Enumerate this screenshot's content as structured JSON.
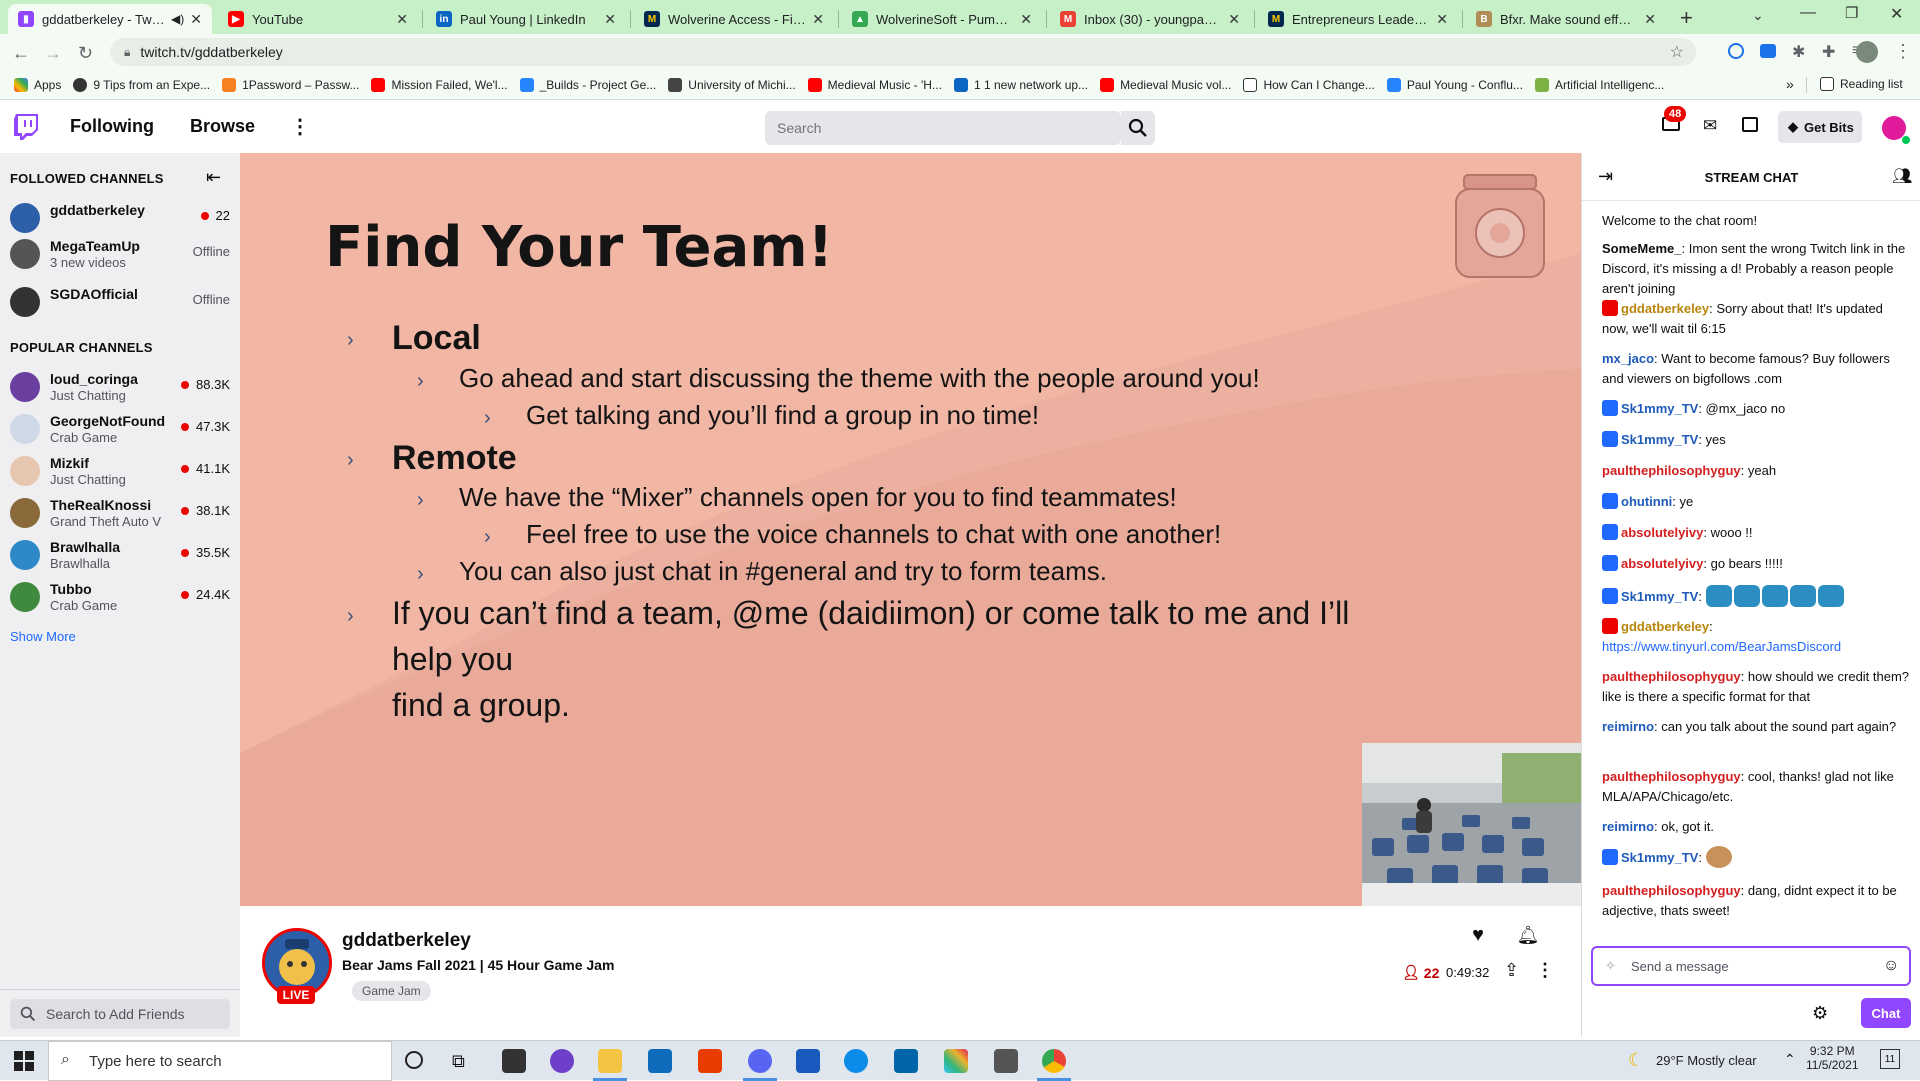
{
  "browser": {
    "tabs": [
      {
        "title": "gddatberkeley - Twitch",
        "active": true,
        "color": "#9147ff"
      },
      {
        "title": "YouTube",
        "active": false,
        "color": "#ff0000"
      },
      {
        "title": "Paul Young | LinkedIn",
        "active": false,
        "color": "#0a66c2"
      },
      {
        "title": "Wolverine Access - Find & ...",
        "active": false,
        "color": "#00274c"
      },
      {
        "title": "WolverineSoft - Pumpkin C...",
        "active": false,
        "color": "#34a853"
      },
      {
        "title": "Inbox (30) - youngpau@u...",
        "active": false,
        "color": "#ea4335"
      },
      {
        "title": "Entrepreneurs Leadership ...",
        "active": false,
        "color": "#00274c"
      },
      {
        "title": "Bfxr. Make sound effects f...",
        "active": false,
        "color": "#b08d57"
      }
    ],
    "url": "twitch.tv/gddatberkeley",
    "bookmarks": [
      "Apps",
      "9 Tips from an Expe...",
      "1Password – Passw...",
      "Mission Failed, We'l...",
      "_Builds - Project Ge...",
      "University of Michi...",
      "Medieval Music - 'H...",
      "1 1 new network up...",
      "Medieval Music vol...",
      "How Can I Change...",
      "Paul Young - Conflu...",
      "Artificial Intelligenc..."
    ],
    "reading_list": "Reading list",
    "more_bookmarks": "»"
  },
  "twitch": {
    "nav": {
      "following": "Following",
      "browse": "Browse",
      "search_placeholder": "Search",
      "notif_count": "48",
      "get_bits": "Get Bits"
    },
    "sidebar": {
      "followed_header": "FOLLOWED CHANNELS",
      "followed": [
        {
          "name": "gddatberkeley",
          "sub": "",
          "status": "22",
          "live": true,
          "color": "#2d5ea8"
        },
        {
          "name": "MegaTeamUp",
          "sub": "3 new videos",
          "status": "Offline",
          "live": false,
          "color": "#555"
        },
        {
          "name": "SGDAOfficial",
          "sub": "",
          "status": "Offline",
          "live": false,
          "color": "#333"
        }
      ],
      "popular_header": "POPULAR CHANNELS",
      "popular": [
        {
          "name": "loud_coringa",
          "sub": "Just Chatting",
          "status": "88.3K",
          "color": "#6a3fa0"
        },
        {
          "name": "GeorgeNotFound",
          "sub": "Crab Game",
          "status": "47.3K",
          "color": "#cfd8e6"
        },
        {
          "name": "Mizkif",
          "sub": "Just Chatting",
          "status": "41.1K",
          "color": "#e8c7b0"
        },
        {
          "name": "TheRealKnossi",
          "sub": "Grand Theft Auto V",
          "status": "38.1K",
          "color": "#8a6a3a"
        },
        {
          "name": "Brawlhalla",
          "sub": "Brawlhalla",
          "status": "35.5K",
          "color": "#2f88c8"
        },
        {
          "name": "Tubbo",
          "sub": "Crab Game",
          "status": "24.4K",
          "color": "#3f8a3f"
        }
      ],
      "show_more": "Show More",
      "friend_search_placeholder": "Search to Add Friends"
    },
    "slide": {
      "title": "Find Your Team!",
      "local": "Local",
      "local_1": "Go ahead and start discussing the theme with the people around you!",
      "local_1a": "Get talking and you’ll find a group in no time!",
      "remote": "Remote",
      "remote_1": "We have the “Mixer” channels open for you to find teammates!",
      "remote_1a": "Feel free to use the voice channels to chat with one another!",
      "remote_2": "You can also just chat in #general and try to form teams.",
      "help_line1": "If you can’t find a team, @me (daidiimon) or come talk to me and I’ll help you",
      "help_line2": "find a group."
    },
    "stream_info": {
      "channel": "gddatberkeley",
      "title": "Bear Jams Fall 2021 | 45 Hour Game Jam",
      "tag": "Game Jam",
      "live": "LIVE",
      "viewers": "22",
      "uptime": "0:49:32"
    },
    "chat": {
      "header": "STREAM CHAT",
      "welcome": "Welcome to the chat room!",
      "messages": [
        {
          "user": "SomeMeme_",
          "color": "#0e0e10",
          "badge": "",
          "text": ": Imon sent the wrong Twitch link in the Discord, it's missing a d! Probably a reason people aren't joining"
        },
        {
          "user": "gddatberkeley",
          "color": "#b8860b",
          "badge": "cam",
          "text": ": Sorry about that! It's updated now, we'll wait til 6:15"
        },
        {
          "user": "mx_jaco",
          "color": "#1e5bb8",
          "badge": "",
          "text": ": Want to become famous? Buy followers and viewers on bigfollows .com"
        },
        {
          "user": "Sk1mmy_TV",
          "color": "#1e5bb8",
          "badge": "prime",
          "text": ": @mx_jaco no"
        },
        {
          "user": "Sk1mmy_TV",
          "color": "#1e5bb8",
          "badge": "prime",
          "text": ": yes"
        },
        {
          "user": "paulthephilosophyguy",
          "color": "#d42020",
          "badge": "",
          "text": ": yeah"
        },
        {
          "user": "ohutinni",
          "color": "#1e5bb8",
          "badge": "prime",
          "text": ": ye"
        },
        {
          "user": "absolutelyivy",
          "color": "#d42020",
          "badge": "prime",
          "text": ": wooo !!"
        },
        {
          "user": "absolutelyivy",
          "color": "#d42020",
          "badge": "prime",
          "text": ": go bears !!!!!"
        },
        {
          "user": "Sk1mmy_TV",
          "color": "#1e5bb8",
          "badge": "prime",
          "text": ":"
        },
        {
          "user": "gddatberkeley",
          "color": "#b8860b",
          "badge": "cam",
          "text": ":"
        },
        {
          "user": "",
          "color": "#1f69ff",
          "badge": "",
          "text": "https://www.tinyurl.com/BearJamsDiscord"
        },
        {
          "user": "paulthephilosophyguy",
          "color": "#d42020",
          "badge": "",
          "text": ": how should we credit them? like is there a specific format for that"
        },
        {
          "user": "reimirno",
          "color": "#1e5bb8",
          "badge": "",
          "text": ": can you talk about the sound part again?"
        },
        {
          "user": "paulthephilosophyguy",
          "color": "#d42020",
          "badge": "",
          "text": ": cool, thanks! glad not like MLA/APA/Chicago/etc."
        },
        {
          "user": "reimirno",
          "color": "#1e5bb8",
          "badge": "",
          "text": ": ok, got it."
        },
        {
          "user": "Sk1mmy_TV",
          "color": "#1e5bb8",
          "badge": "prime",
          "text": ":"
        },
        {
          "user": "paulthephilosophyguy",
          "color": "#d42020",
          "badge": "",
          "text": ": dang, didnt expect it to be adjective, thats sweet!"
        }
      ],
      "input_placeholder": "Send a message",
      "send_label": "Chat"
    }
  },
  "taskbar": {
    "search_placeholder": "Type here to search",
    "weather": "29°F  Mostly clear",
    "time": "9:32 PM",
    "date": "11/5/2021",
    "notif": "11"
  }
}
